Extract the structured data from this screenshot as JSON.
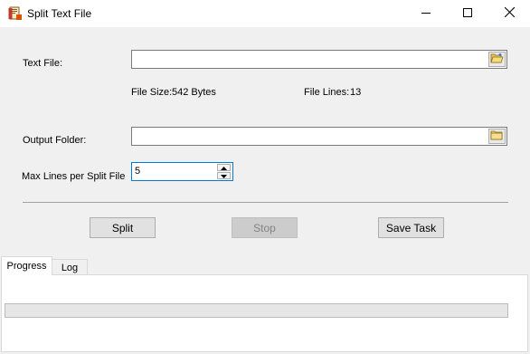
{
  "window": {
    "title": "Split Text File",
    "icons": {
      "app": "document-scissors-icon",
      "minimize": "minimize-icon",
      "maximize": "maximize-icon",
      "close": "close-icon"
    }
  },
  "form": {
    "text_file_label": "Text File:",
    "text_file_value": "",
    "file_size_label": "File Size:",
    "file_size_value": "542 Bytes",
    "file_lines_label": "File Lines:",
    "file_lines_value": "13",
    "output_folder_label": "Output Folder:",
    "output_folder_value": "",
    "max_lines_label": "Max Lines per Split File",
    "max_lines_value": "5"
  },
  "actions": {
    "split_label": "Split",
    "stop_label": "Stop",
    "stop_enabled": false,
    "save_task_label": "Save Task"
  },
  "tabs": [
    {
      "label": "Progress",
      "active": true
    },
    {
      "label": "Log",
      "active": false
    }
  ],
  "progress": {
    "value": 0
  },
  "colors": {
    "accent": "#0078d7",
    "progress_fill": "#06b025"
  }
}
